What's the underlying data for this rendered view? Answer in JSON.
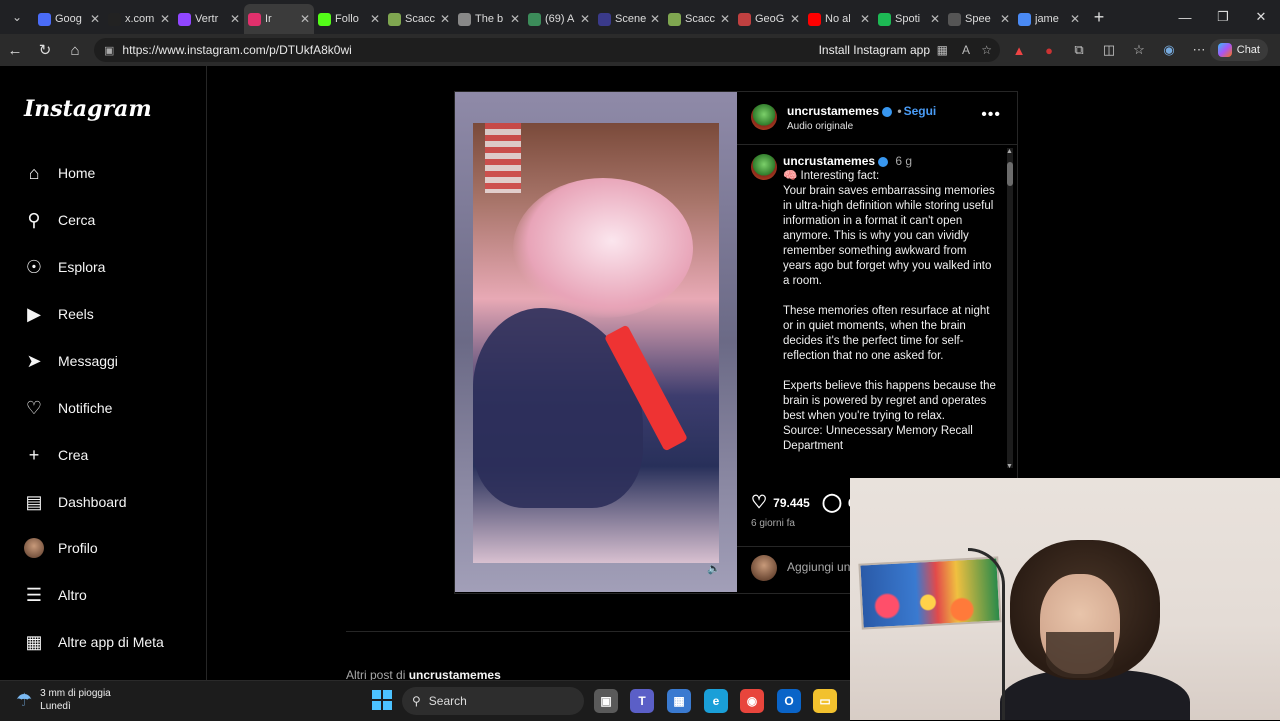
{
  "browser": {
    "tabs": [
      {
        "title": "Goog",
        "color": "#4a6cf7"
      },
      {
        "title": "x.com",
        "color": "#222222"
      },
      {
        "title": "Vertr",
        "color": "#9146ff"
      },
      {
        "title": "Ir",
        "color": "#e1306c",
        "active": true
      },
      {
        "title": "Follo",
        "color": "#53fc18"
      },
      {
        "title": "Scacc",
        "color": "#7fa650"
      },
      {
        "title": "The b",
        "color": "#888888"
      },
      {
        "title": "(69) A",
        "color": "#3c8c5a"
      },
      {
        "title": "Scene",
        "color": "#3a3a8a"
      },
      {
        "title": "Scacc",
        "color": "#7fa650"
      },
      {
        "title": "GeoG",
        "color": "#c04040"
      },
      {
        "title": "No al",
        "color": "#ff0000"
      },
      {
        "title": "Spoti",
        "color": "#1db954"
      },
      {
        "title": "Spee",
        "color": "#555555"
      },
      {
        "title": "jame",
        "color": "#4a8af4"
      }
    ],
    "url": "https://www.instagram.com/p/DTUkfA8k0wi",
    "install_label": "Install Instagram app",
    "chat_label": "Chat"
  },
  "instagram": {
    "logo": "Instagram",
    "nav": [
      {
        "label": "Home",
        "icon": "home-icon"
      },
      {
        "label": "Cerca",
        "icon": "search-icon"
      },
      {
        "label": "Esplora",
        "icon": "compass-icon"
      },
      {
        "label": "Reels",
        "icon": "reels-icon"
      },
      {
        "label": "Messaggi",
        "icon": "messages-icon"
      },
      {
        "label": "Notifiche",
        "icon": "heart-icon"
      },
      {
        "label": "Crea",
        "icon": "plus-icon"
      },
      {
        "label": "Dashboard",
        "icon": "dashboard-icon"
      },
      {
        "label": "Profilo",
        "icon": "profile-avatar"
      },
      {
        "label": "Altro",
        "icon": "menu-icon"
      },
      {
        "label": "Altre app di Meta",
        "icon": "meta-apps-icon"
      }
    ]
  },
  "post": {
    "username": "uncrustamemes",
    "follow_label": "Segui",
    "separator": "•",
    "audio": "Audio originale",
    "caption_time": "6 g",
    "caption_text": "🧠 Interesting fact:\nYour brain saves embarrassing memories in ultra-high definition while storing useful information in a format it can't open anymore. This is why you can vividly remember something awkward from years ago but forget why you walked into a room.\n\nThese memories often resurface at night or in quiet moments, when the brain decides it's the perfect time for self-reflection that no one asked for.\n\nExperts believe this happens because the brain is powered by regret and operates best when you're trying to relax.\nSource: Unnecessary Memory Recall Department",
    "likes": "79.445",
    "comments_partial": "6",
    "date": "6 giorni fa",
    "add_comment": "Aggiungi un",
    "more_posts_prefix": "Altri post di",
    "more_posts_user": "uncrustamemes"
  },
  "taskbar": {
    "weather_line1": "3 mm di pioggia",
    "weather_line2": "Lunedì",
    "search_label": "Search",
    "apps": [
      {
        "name": "task-view",
        "color": "#5a5a5a"
      },
      {
        "name": "teams",
        "color": "#5b5fc7"
      },
      {
        "name": "store",
        "color": "#3a7ad0"
      },
      {
        "name": "edge",
        "color": "#1a9fd8"
      },
      {
        "name": "chrome",
        "color": "#e8453c"
      },
      {
        "name": "outlook",
        "color": "#0a64c8"
      },
      {
        "name": "explorer",
        "color": "#f2c12e"
      }
    ]
  }
}
